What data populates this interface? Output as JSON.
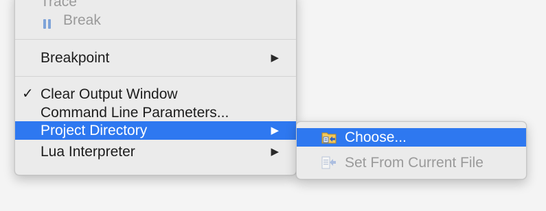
{
  "main_menu": {
    "items": [
      {
        "label": "Trace",
        "disabled": true
      },
      {
        "label": "Break",
        "disabled": true,
        "icon": "pause-icon"
      },
      {
        "label": "Breakpoint",
        "submenu": true
      },
      {
        "label": "Clear Output Window",
        "checked": true
      },
      {
        "label": "Command Line Parameters..."
      },
      {
        "label": "Project Directory",
        "submenu": true,
        "highlighted": true
      },
      {
        "label": "Lua Interpreter",
        "submenu": true
      }
    ],
    "submenu_arrow": "▶",
    "check_mark": "✓"
  },
  "sub_menu": {
    "items": [
      {
        "label": "Choose...",
        "highlighted": true,
        "icon": "folder-choose-icon"
      },
      {
        "label": "Set From Current File",
        "disabled": true,
        "icon": "file-set-icon"
      }
    ]
  },
  "colors": {
    "highlight": "#2e78f0",
    "disabled_text": "#9a9a9a",
    "pause_icon": "#7ea3d8"
  }
}
